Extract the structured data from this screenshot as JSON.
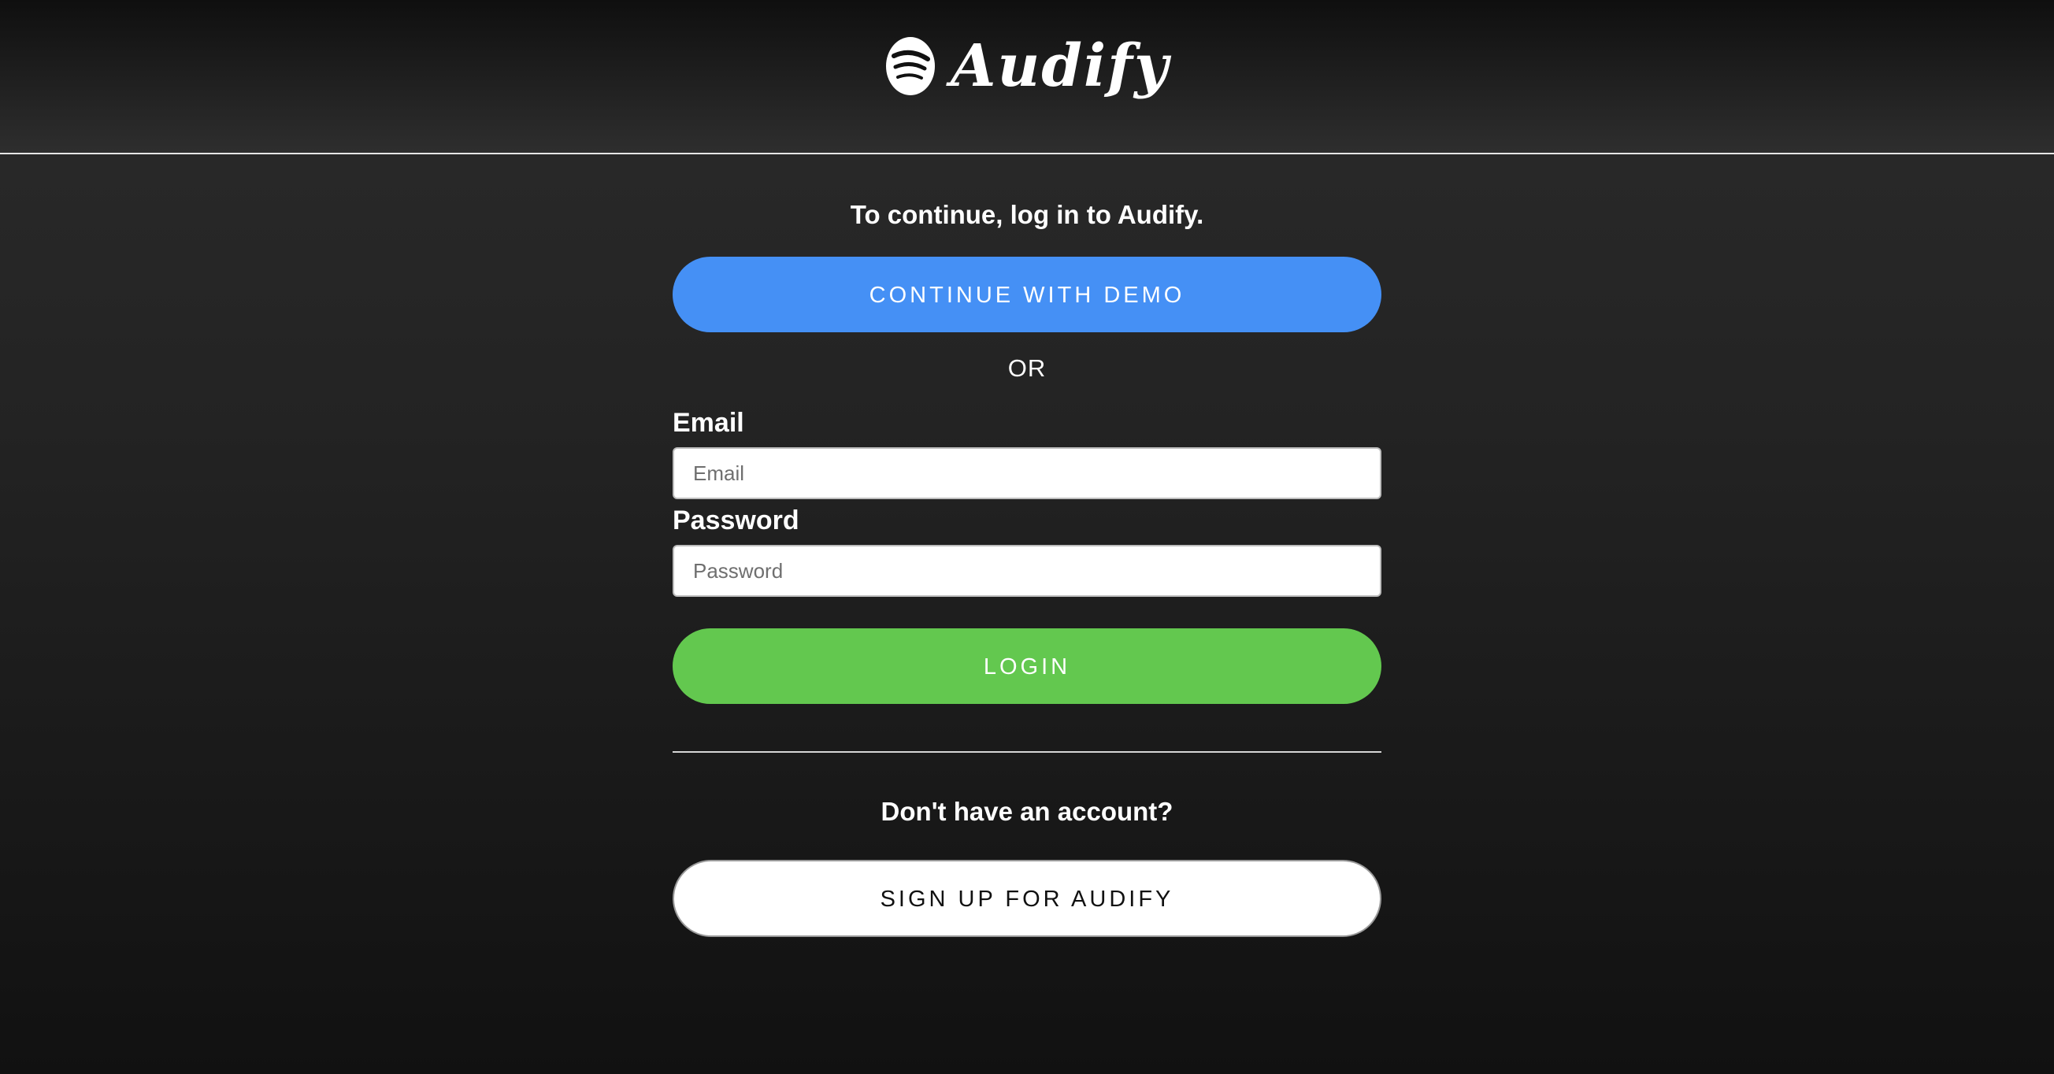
{
  "header": {
    "brand_name": "Audify",
    "logo_icon": "audify-logo-icon"
  },
  "login": {
    "prompt": "To continue, log in to Audify.",
    "demo_button_label": "CONTINUE WITH DEMO",
    "separator_text": "OR",
    "email_label": "Email",
    "email_placeholder": "Email",
    "email_value": "",
    "password_label": "Password",
    "password_placeholder": "Password",
    "password_value": "",
    "login_button_label": "LOGIN"
  },
  "signup": {
    "prompt": "Don't have an account?",
    "button_label": "SIGN UP FOR AUDIFY"
  },
  "colors": {
    "demo_button": "#4590f5",
    "login_button": "#63c84f",
    "signup_button": "#ffffff",
    "background": "#1b1b1b"
  }
}
